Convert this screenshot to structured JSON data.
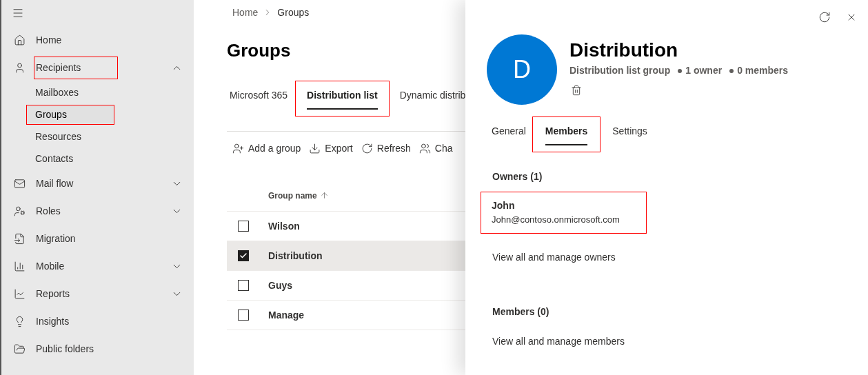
{
  "nav": {
    "items": [
      {
        "label": "Home",
        "selected": false,
        "highlighted": false
      },
      {
        "label": "Recipients",
        "expanded": true,
        "selected": false,
        "highlighted": true,
        "children": [
          {
            "label": "Mailboxes",
            "selected": false,
            "highlighted": false
          },
          {
            "label": "Groups",
            "selected": true,
            "highlighted": true
          },
          {
            "label": "Resources",
            "selected": false,
            "highlighted": false
          },
          {
            "label": "Contacts",
            "selected": false,
            "highlighted": false
          }
        ]
      },
      {
        "label": "Mail flow",
        "expanded": false,
        "selected": false,
        "highlighted": false
      },
      {
        "label": "Roles",
        "expanded": false,
        "selected": false,
        "highlighted": false
      },
      {
        "label": "Migration",
        "selected": false,
        "highlighted": false
      },
      {
        "label": "Mobile",
        "expanded": false,
        "selected": false,
        "highlighted": false
      },
      {
        "label": "Reports",
        "expanded": false,
        "selected": false,
        "highlighted": false
      },
      {
        "label": "Insights",
        "selected": false,
        "highlighted": false
      },
      {
        "label": "Public folders",
        "selected": false,
        "highlighted": false
      }
    ]
  },
  "breadcrumb": [
    "Home",
    "Groups"
  ],
  "page_title": "Groups",
  "tabs": [
    {
      "label": "Microsoft 365",
      "selected": false,
      "highlighted": false
    },
    {
      "label": "Distribution list",
      "selected": true,
      "highlighted": true
    },
    {
      "label": "Dynamic distrib",
      "selected": false,
      "highlighted": false
    }
  ],
  "toolbar": [
    "Add a group",
    "Export",
    "Refresh",
    "Cha"
  ],
  "table": {
    "columns": [
      "Group name"
    ],
    "rows": [
      {
        "name": "Wilson",
        "checked": false,
        "selected": false
      },
      {
        "name": "Distribution",
        "checked": true,
        "selected": true
      },
      {
        "name": "Guys",
        "checked": false,
        "selected": false
      },
      {
        "name": "Manage",
        "checked": false,
        "selected": false
      }
    ]
  },
  "panel": {
    "avatar": "D",
    "title": "Distribution",
    "meta": [
      "Distribution list group",
      "1 owner",
      "0 members"
    ],
    "tabs": [
      {
        "label": "General",
        "selected": false,
        "highlighted": false
      },
      {
        "label": "Members",
        "selected": true,
        "highlighted": true
      },
      {
        "label": "Settings",
        "selected": false,
        "highlighted": false
      }
    ],
    "owners": {
      "heading": "Owners (1)",
      "people": [
        {
          "name": "John",
          "email": "John@contoso.onmicrosoft.com",
          "highlighted": true
        }
      ],
      "link": "View all and manage owners"
    },
    "members": {
      "heading": "Members (0)",
      "link": "View all and manage members"
    }
  }
}
